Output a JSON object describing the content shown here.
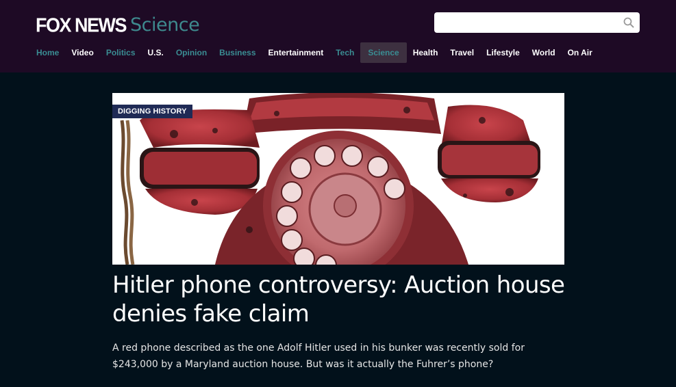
{
  "header": {
    "logo_brand": "FOX NEWS",
    "logo_section": "Science",
    "search": {
      "placeholder": "",
      "value": "",
      "icon": "search-icon"
    }
  },
  "nav": {
    "items": [
      {
        "label": "Home",
        "color": "teal"
      },
      {
        "label": "Video",
        "color": "white"
      },
      {
        "label": "Politics",
        "color": "teal"
      },
      {
        "label": "U.S.",
        "color": "white"
      },
      {
        "label": "Opinion",
        "color": "teal"
      },
      {
        "label": "Business",
        "color": "teal"
      },
      {
        "label": "Entertainment",
        "color": "white"
      },
      {
        "label": "Tech",
        "color": "teal"
      },
      {
        "label": "Science",
        "color": "teal",
        "active": true
      },
      {
        "label": "Health",
        "color": "white"
      },
      {
        "label": "Travel",
        "color": "white"
      },
      {
        "label": "Lifestyle",
        "color": "white"
      },
      {
        "label": "World",
        "color": "white"
      },
      {
        "label": "On Air",
        "color": "white"
      }
    ]
  },
  "article": {
    "badge": "DIGGING HISTORY",
    "image": "red-rotary-phone-image",
    "headline": "Hitler phone controversy: Auction house denies fake claim",
    "summary": "A red phone described as the one Adolf Hitler used in his bunker was recently sold for $243,000 by a Maryland auction house. But was it actually the Fuhrer’s phone?"
  },
  "colors": {
    "header_bg": "#1e0a25",
    "page_bg": "#02111b",
    "accent_teal": "#3a8d93",
    "badge_bg": "#1f2a55",
    "active_nav_bg": "#3d3040"
  }
}
